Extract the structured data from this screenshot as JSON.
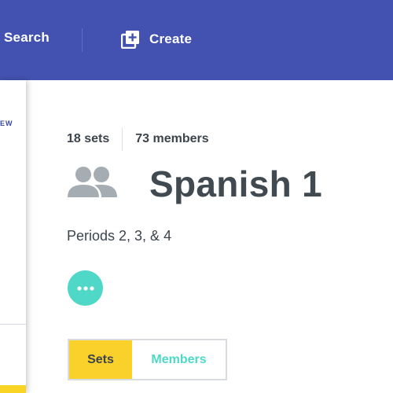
{
  "nav": {
    "search_label": "Search",
    "create_label": "Create"
  },
  "side_panel": {
    "text": "EW"
  },
  "class": {
    "sets_count": "18 sets",
    "members_count": "73 members",
    "title": "Spanish 1",
    "subtitle": "Periods 2, 3, & 4"
  },
  "tabs": [
    {
      "label": "Sets",
      "active": true
    },
    {
      "label": "Members",
      "active": false
    }
  ],
  "icons": {
    "create": "add-folder-icon",
    "group": "group-icon",
    "more": "more-options-icon"
  },
  "colors": {
    "header_bg": "#4352b0",
    "accent_teal": "#4fd8c7",
    "accent_yellow": "#fad12a",
    "title_text": "#404a50"
  }
}
